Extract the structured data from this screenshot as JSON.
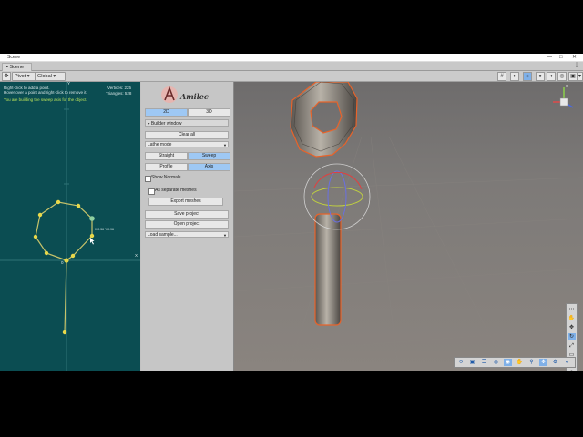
{
  "window": {
    "title": "Scene",
    "controls": [
      "—",
      "□",
      "✕"
    ]
  },
  "tabs": [
    {
      "label": "Scene"
    }
  ],
  "toolbar": {
    "pivot_label": "Pivot",
    "global_label": "Global",
    "right_icons": [
      "grid-icon",
      "2d-icon",
      "lighting-icon",
      "audio-icon",
      "effects-icon",
      "visibility-icon",
      "camera-icon",
      "gizmos-icon"
    ]
  },
  "canvas2d": {
    "info_lines": [
      "Right-click to add a point.",
      "Hover over a point and right-click to remove it."
    ],
    "hint": "You are building the sweep axis for the object.",
    "vertices": "Vertices: 225",
    "triangles": "Triangles: 528",
    "axis_x_label": "X",
    "axis_y_label": "Y",
    "origin_label": "0",
    "point_label": "X:0.56 Y:0.96"
  },
  "builder": {
    "logo_text": "Amilec",
    "mode_2d": "2D",
    "mode_3d": "3D",
    "section_title": "Builder window",
    "clear_all": "Clear all",
    "lathe_mode": "Lathe mode",
    "straight": "Straight",
    "sweep": "Sweep",
    "profile": "Profile",
    "axis": "Axis",
    "show_normals": "Show Normals",
    "as_separate_meshes": "As separate meshes",
    "export_meshes": "Export meshes",
    "save_project": "Save project",
    "open_project": "Open project",
    "load_sample": "Load sample..."
  },
  "scene_tools": [
    "view-tool-icon",
    "hand-icon",
    "move-icon",
    "rotate-icon",
    "scale-icon",
    "rect-icon",
    "transform-icon",
    "custom-icon",
    "snap-icon",
    "more-icon"
  ],
  "bottom_tools": [
    "orbit-icon",
    "camera-icon",
    "layers-icon",
    "sphere-icon",
    "globe-icon",
    "hand-icon",
    "zoom-icon",
    "frame-icon",
    "settings-icon"
  ],
  "colors": {
    "canvas_bg": "#0b4d52",
    "profile_line": "#c7c36a",
    "point": "#e8d84a",
    "selected_button": "#9ec8f4",
    "selection_outline": "#e8632a"
  }
}
